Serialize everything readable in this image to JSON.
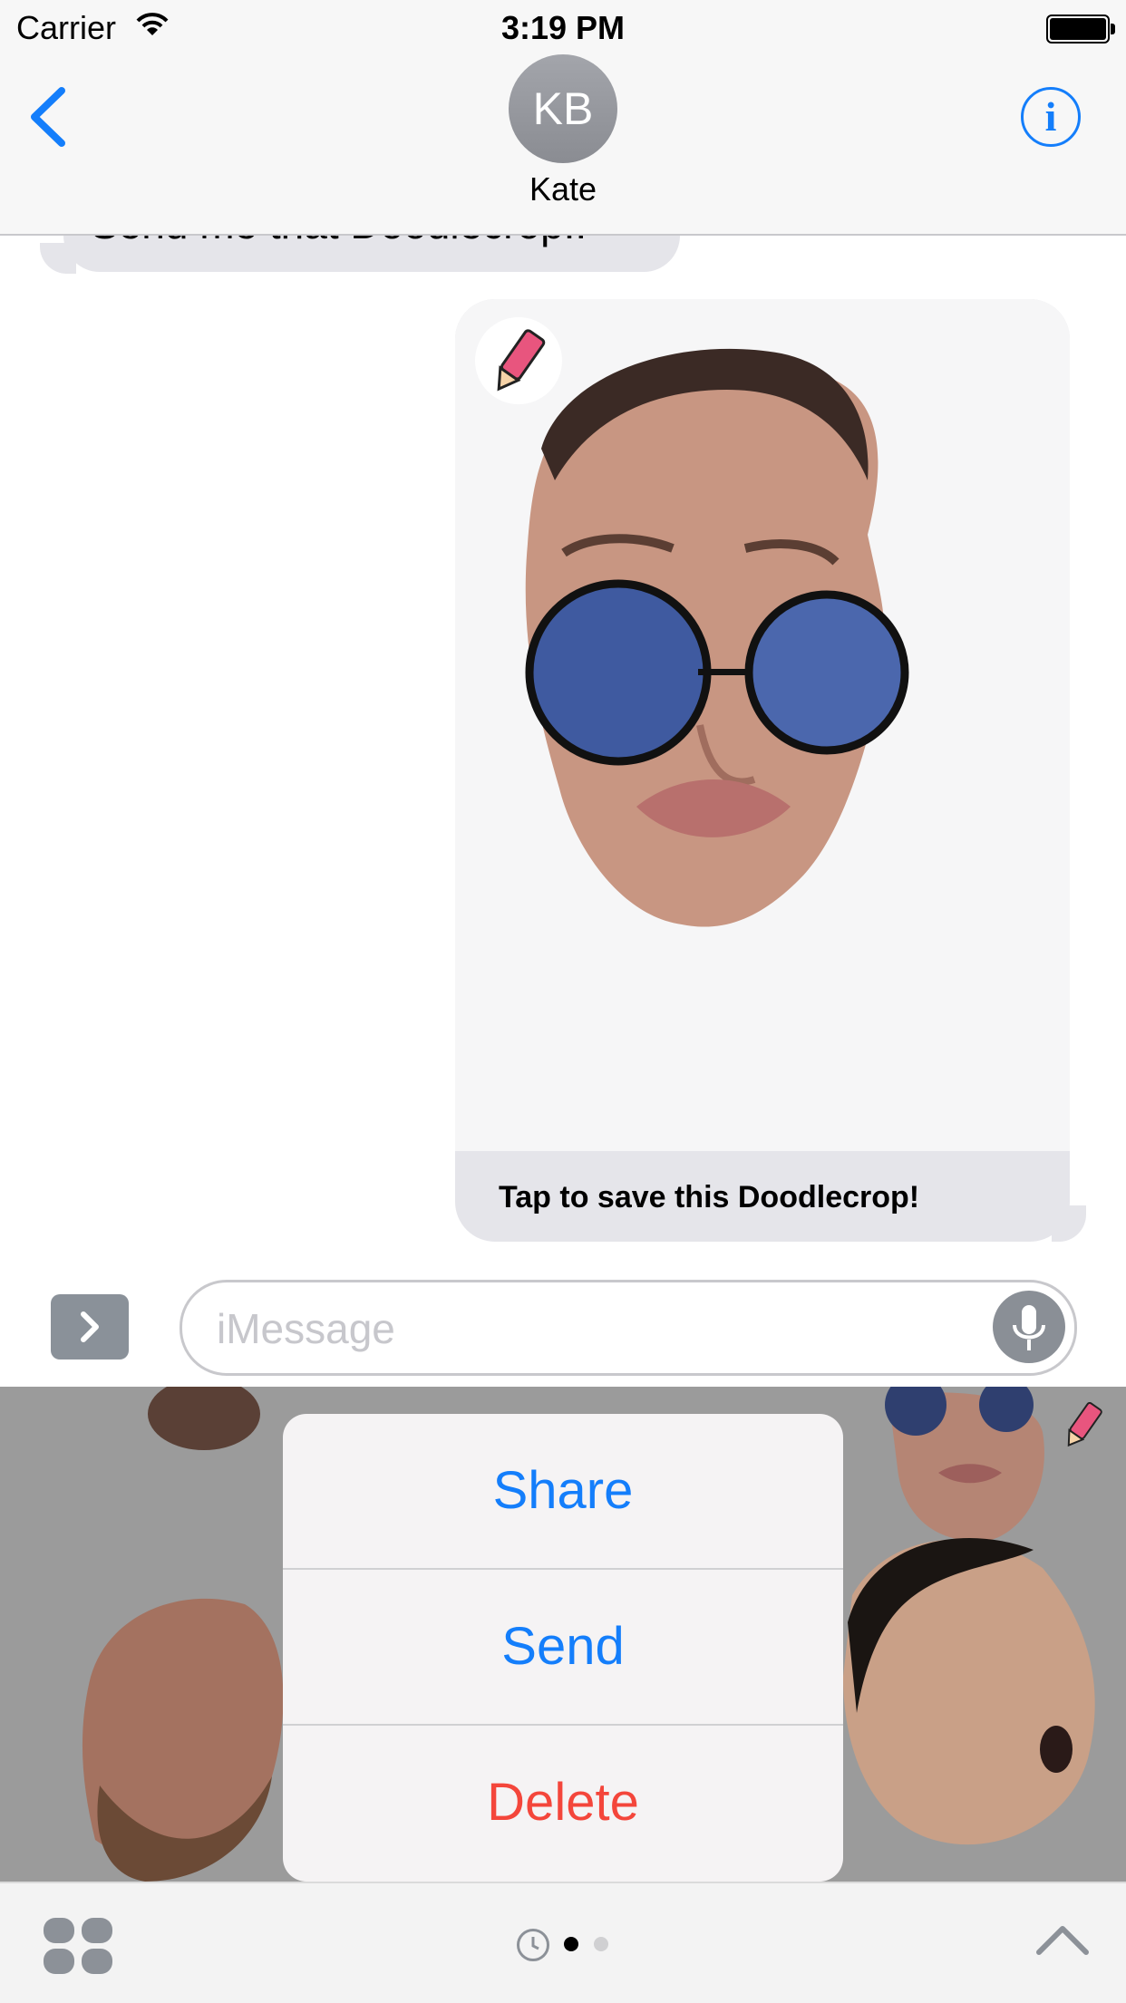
{
  "status_bar": {
    "carrier": "Carrier",
    "time": "3:19 PM"
  },
  "conversation": {
    "contact_initials": "KB",
    "contact_name": "Kate"
  },
  "messages": {
    "incoming_text": "Send me that Doodlecrop..",
    "outgoing_caption": "Tap to save this Doodlecrop!"
  },
  "composer": {
    "placeholder": "iMessage"
  },
  "action_sheet": {
    "share": "Share",
    "send": "Send",
    "delete": "Delete"
  },
  "colors": {
    "accent": "#147efb",
    "destructive": "#f4463b",
    "bubble": "#e5e5ea"
  },
  "icons": [
    "wifi-icon",
    "battery-icon",
    "back-chevron-icon",
    "info-icon",
    "pencil-app-icon",
    "expand-icon",
    "microphone-icon",
    "app-drawer-icon",
    "recents-icon",
    "chevron-up-icon"
  ]
}
